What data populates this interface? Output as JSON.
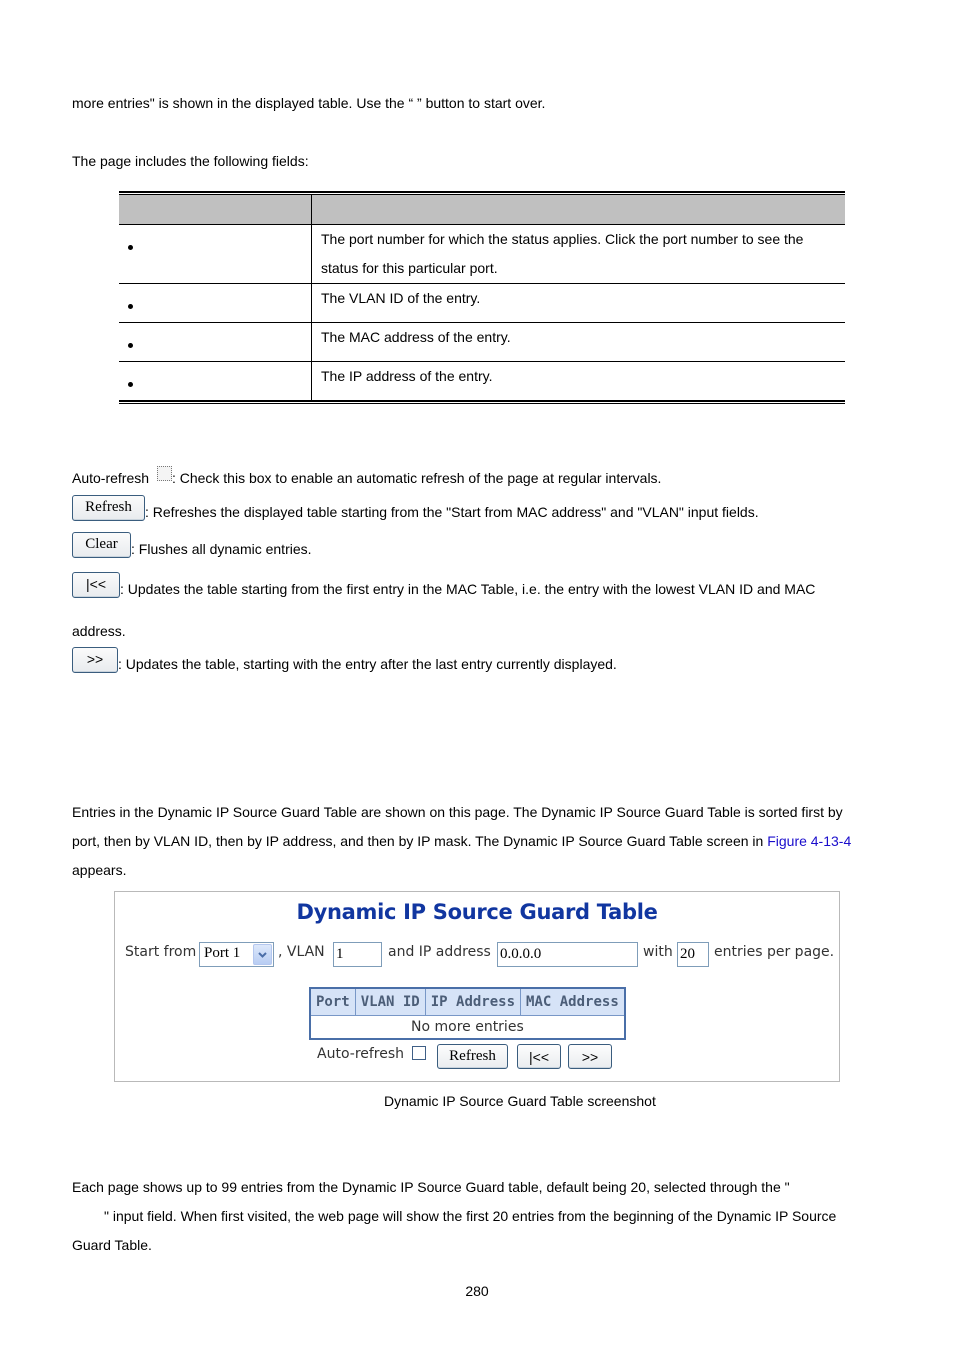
{
  "intro": {
    "line1": "more entries\" is shown in the displayed table. Use the “      ” button to start over.",
    "line2": "The page includes the following fields:"
  },
  "fields_table": {
    "header": [
      "",
      ""
    ],
    "rows": [
      {
        "object": "",
        "description_lines": [
          "The port number for which the status applies. Click the port number to see the",
          "status for this particular port."
        ]
      },
      {
        "object": "",
        "description_lines": [
          "The VLAN ID of the entry."
        ]
      },
      {
        "object": "",
        "description_lines": [
          "The MAC address of the entry."
        ]
      },
      {
        "object": "",
        "description_lines": [
          "The IP address of the entry."
        ]
      }
    ]
  },
  "buttons_help": {
    "autorefresh": {
      "label": "Auto-refresh",
      "text": ": Check this box to enable an automatic refresh of the page at regular intervals."
    },
    "refresh": {
      "label": "Refresh",
      "text": ": Refreshes the displayed table starting from the \"Start from MAC address\" and \"VLAN\" input fields."
    },
    "clear": {
      "label": "Clear",
      "text": ": Flushes all dynamic entries."
    },
    "first": {
      "label": "|<<",
      "text_line1": ": Updates the table starting from the first entry in the MAC Table, i.e. the entry with the lowest VLAN ID and MAC",
      "text_line2": "address."
    },
    "next": {
      "label": ">>",
      "text": ": Updates the table, starting with the entry after the last entry currently displayed."
    }
  },
  "section": {
    "para_line1": "Entries in the Dynamic IP Source Guard Table are shown on this page. The Dynamic IP Source Guard Table is sorted first by",
    "para_line2_pre": "port, then by VLAN ID, then by IP address, and then by IP mask. The Dynamic IP Source Guard Table screen in ",
    "para_line2_link": "Figure 4-13-4",
    "para_line3": "appears."
  },
  "screenshot": {
    "title": "Dynamic IP Source Guard Table",
    "start_from_label": "Start from",
    "port_select_value": "Port 1",
    "vlan_label": ", VLAN",
    "vlan_value": "1",
    "ip_label": "and IP address",
    "ip_value": "0.0.0.0",
    "with_label": "with",
    "entries_value": "20",
    "entries_label": "entries per page.",
    "table_headers": [
      "Port",
      "VLAN ID",
      "IP Address",
      "MAC Address"
    ],
    "table_empty": "No more entries",
    "autorefresh_label": "Auto-refresh",
    "refresh_button": "Refresh",
    "first_button": "|<<",
    "next_button": ">>"
  },
  "caption": "Dynamic IP Source Guard Table screenshot",
  "footer_para": {
    "line1": "Each page shows up to 99 entries from the Dynamic IP Source Guard table, default being 20, selected through the \"",
    "line2": "\" input field. When first visited, the web page will show the first 20 entries from the beginning of the Dynamic IP Source",
    "line3": "Guard Table."
  },
  "page_number": "280"
}
